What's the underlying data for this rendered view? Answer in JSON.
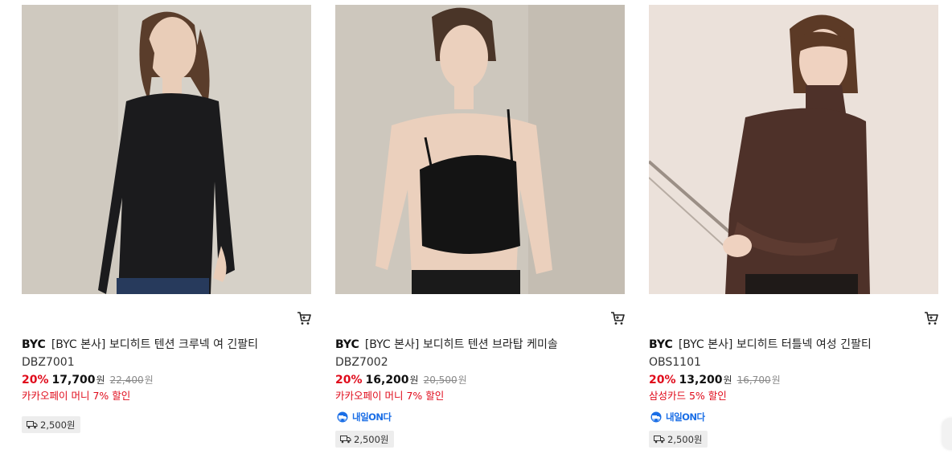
{
  "products": [
    {
      "brand": "BYC",
      "name": "[BYC 본사] 보디히트 텐션 크루넥 여 긴팔티",
      "code": "DBZ7001",
      "discount": "20%",
      "price": "17,700",
      "price_unit": "원",
      "original_price": "22,400",
      "original_unit": "원",
      "promo": "카카오페이 머니 7% 할인",
      "next_day": "",
      "shipping": "2,500원",
      "photo_colors": {
        "bg": "#d4cfc6",
        "top": "#1b1b1d",
        "skin": "#e9cdb8",
        "hair": "#5a3d2b",
        "bottom": "#273a5c"
      }
    },
    {
      "brand": "BYC",
      "name": "[BYC 본사] 보디히트 텐션 브라탑 케미솔",
      "code": "DBZ7002",
      "discount": "20%",
      "price": "16,200",
      "price_unit": "원",
      "original_price": "20,500",
      "original_unit": "원",
      "promo": "카카오페이 머니 7% 할인",
      "next_day": "내일ON다",
      "shipping": "2,500원",
      "photo_colors": {
        "bg": "#cfc9bf",
        "top": "#141414",
        "skin": "#ebd0bd",
        "hair": "#4a3528",
        "bottom": "#1a1a1a"
      }
    },
    {
      "brand": "BYC",
      "name": "[BYC 본사] 보디히트 터틀넥 여성 긴팔티",
      "code": "OBS1101",
      "discount": "20%",
      "price": "13,200",
      "price_unit": "원",
      "original_price": "16,700",
      "original_unit": "원",
      "promo": "삼성카드 5% 할인",
      "next_day": "내일ON다",
      "shipping": "2,500원",
      "photo_colors": {
        "bg": "#e8ddd6",
        "top": "#4e3129",
        "skin": "#efd2c0",
        "hair": "#5c3a26",
        "bottom": "#1f1a18"
      }
    }
  ],
  "icons": {
    "cart": "cart-icon",
    "next_day": "rocket-truck-icon",
    "shipping": "truck-icon"
  },
  "colors": {
    "discount": "#e00b1b",
    "next_day_blue": "#1a6ee6",
    "badge_bg": "#ededed"
  }
}
